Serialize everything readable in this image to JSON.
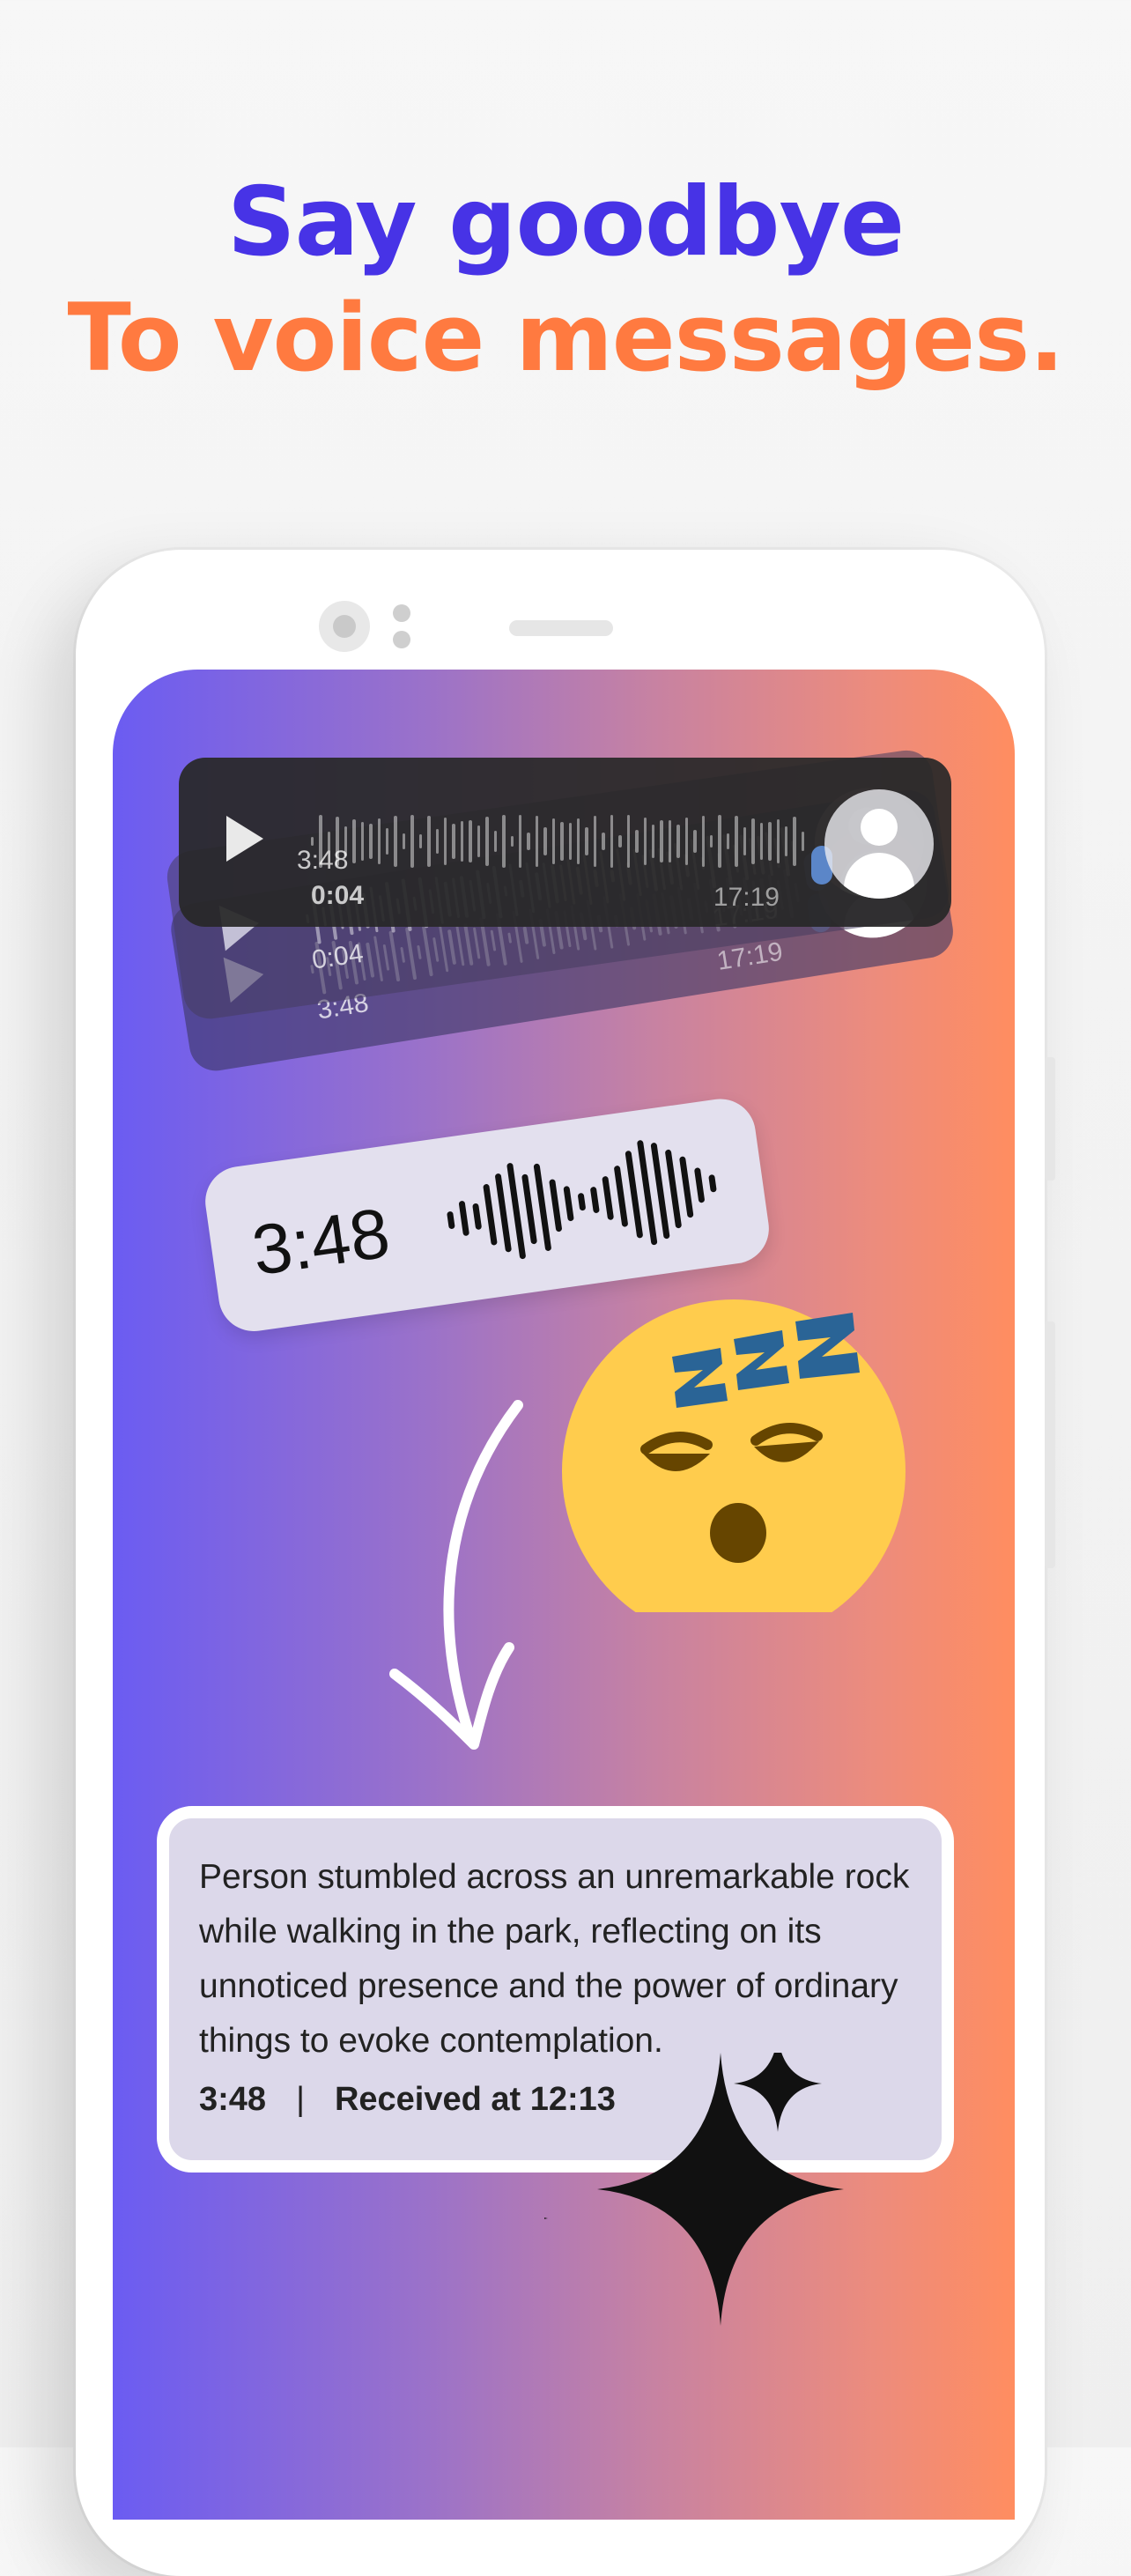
{
  "headline": {
    "line1": "Say goodbye",
    "line2": "To voice messages.",
    "color1": "#4733e6",
    "color2": "#ff7a40"
  },
  "voice_messages": [
    {
      "duration": "0:04",
      "position_label": "3:48",
      "time": "17:19",
      "icon_play": "play-icon",
      "icon_mic": "mic-icon",
      "icon_avatar": "avatar-icon"
    },
    {
      "duration": "0:04",
      "time": "17:19",
      "icon_play": "play-icon",
      "icon_mic": "mic-icon",
      "icon_avatar": "avatar-icon"
    },
    {
      "duration": "3:48",
      "time": "17:19",
      "icon_play": "play-icon",
      "icon_mic": "mic-icon",
      "icon_avatar": "avatar-icon"
    }
  ],
  "pill": {
    "duration": "3:48",
    "icon": "waveform-icon"
  },
  "emoji": {
    "icon": "sleeping-face-emoji"
  },
  "summary": {
    "text": "Person stumbled across an unremarkable rock while walking in the park, reflecting on its unnoticed presence and the power of ordinary things to evoke contemplation.",
    "duration": "3:48",
    "separator": "|",
    "received": "Received at 12:13"
  },
  "colors": {
    "gradient_start": "#6b5cf2",
    "gradient_end": "#ff8d60",
    "card_bg": "#dcd8ea"
  }
}
